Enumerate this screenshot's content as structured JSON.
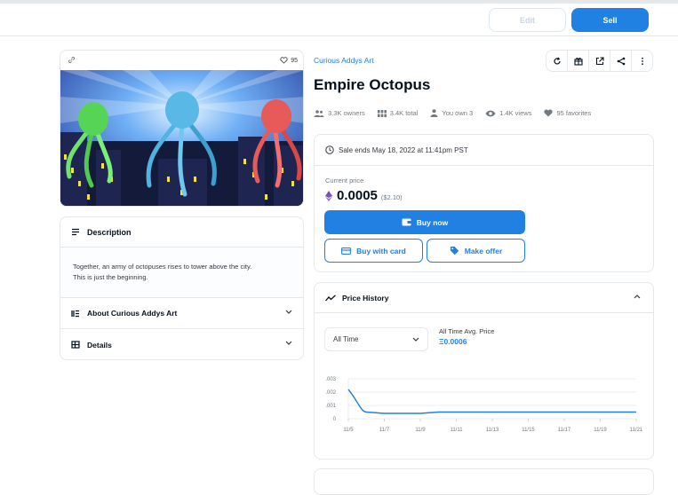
{
  "topbar": {
    "edit_label": "Edit",
    "sell_label": "Sell"
  },
  "asset": {
    "favorites_count": "95"
  },
  "description": {
    "header": "Description",
    "text_line1": "Together, an army of octopuses rises to tower above the city.",
    "text_line2": "This is just the beginning."
  },
  "accordions": [
    {
      "label": "About Curious Addys Art"
    },
    {
      "label": "Details"
    }
  ],
  "collection_name": "Curious Addys Art",
  "title": "Empire Octopus",
  "stats": {
    "owners": "3.3K owners",
    "total": "3.4K total",
    "you_own": "You own 3",
    "views": "1.4K views",
    "favorites": "95 favorites"
  },
  "sale": {
    "ends_text": "Sale ends May 18, 2022 at 11:41pm PST",
    "current_price_label": "Current price",
    "price": "0.0005",
    "usd": "($2.10)",
    "buy_now": "Buy now",
    "buy_with_card": "Buy with card",
    "make_offer": "Make offer"
  },
  "price_history": {
    "header": "Price History",
    "select_value": "All Time",
    "avg_label": "All Time Avg. Price",
    "avg_value": "Ξ0.0006"
  },
  "chart_data": {
    "type": "line",
    "x": [
      "11/5",
      "11/6",
      "11/7",
      "11/8",
      "11/9",
      "11/10",
      "11/11",
      "11/12",
      "11/13",
      "11/14",
      "11/15",
      "11/16",
      "11/17",
      "11/18",
      "11/19",
      "11/20",
      "11/21"
    ],
    "xticks": [
      "11/5",
      "11/7",
      "11/9",
      "11/11",
      "11/13",
      "11/15",
      "11/17",
      "11/19",
      "11/21"
    ],
    "values": [
      0.0022,
      0.0005,
      0.0004,
      0.0004,
      0.0004,
      0.0005,
      0.0005,
      0.0005,
      0.0005,
      0.0005,
      0.0005,
      0.0005,
      0.0005,
      0.0005,
      0.0005,
      0.0005,
      0.0005
    ],
    "yticks": [
      ".003",
      ".002",
      ".001",
      "0"
    ],
    "ylim": [
      0,
      0.003
    ],
    "grid": true,
    "color": "#2081e2"
  }
}
